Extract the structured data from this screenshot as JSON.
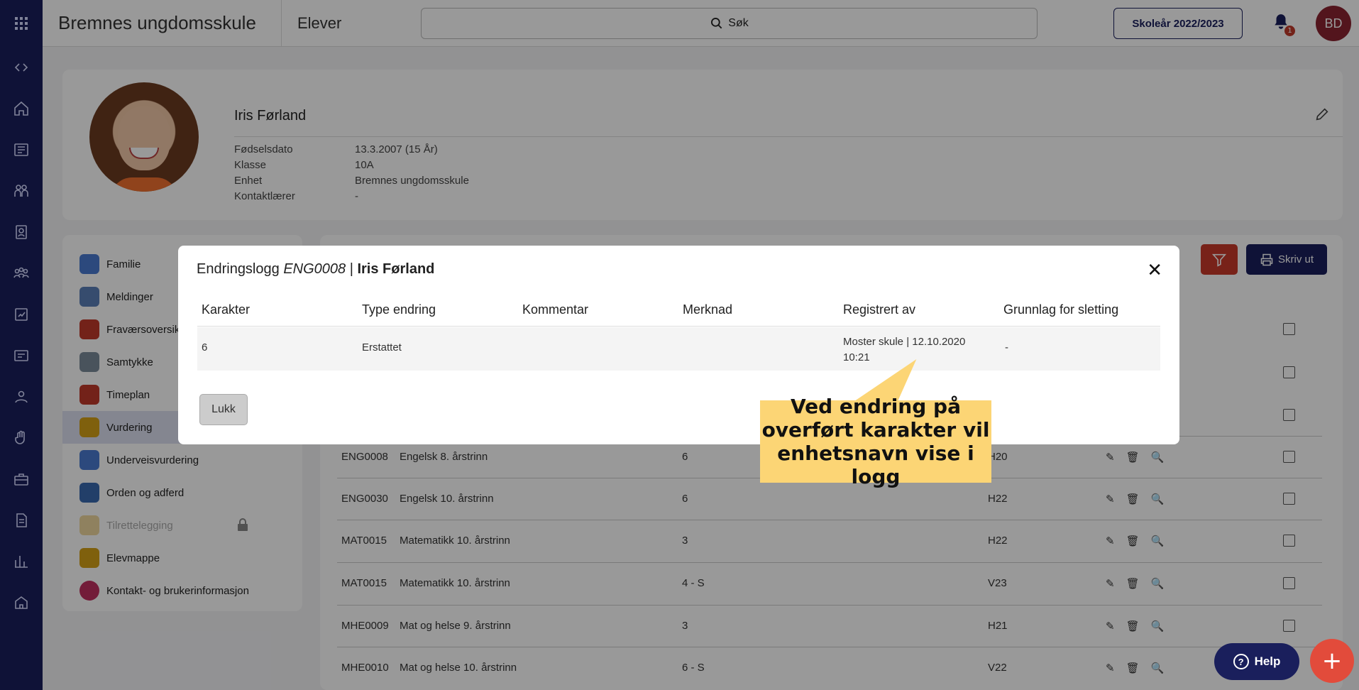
{
  "topbar": {
    "school_name": "Bremnes ungdomsskule",
    "section_title": "Elever",
    "search_label": "Søk",
    "year_button": "Skoleår 2022/2023",
    "notification_count": "1",
    "user_initials": "BD"
  },
  "profile": {
    "name": "Iris Førland",
    "fields": [
      {
        "label": "Fødselsdato",
        "value": "13.3.2007 (15 År)"
      },
      {
        "label": "Klasse",
        "value": "10A"
      },
      {
        "label": "Enhet",
        "value": "Bremnes ungdomsskule"
      },
      {
        "label": "Kontaktlærer",
        "value": "-"
      }
    ]
  },
  "menu": {
    "items": [
      {
        "label": "Familie",
        "color": "#4a7bd0"
      },
      {
        "label": "Meldinger",
        "color": "#5b7fb8"
      },
      {
        "label": "Fraværsoversikt",
        "color": "#c0392b"
      },
      {
        "label": "Samtykke",
        "color": "#7a8a9a"
      },
      {
        "label": "Timeplan",
        "color": "#c0392b"
      },
      {
        "label": "Vurdering",
        "color": "#d4a017"
      },
      {
        "label": "Underveisvurdering",
        "color": "#4a7bd0"
      },
      {
        "label": "Orden og adferd",
        "color": "#3a6ab0"
      },
      {
        "label": "Tilrettelegging",
        "color": "#e0b040"
      },
      {
        "label": "Elevmappe",
        "color": "#d4a017"
      },
      {
        "label": "Kontakt- og brukerinformasjon",
        "color": "#c03060"
      }
    ]
  },
  "toolbar": {
    "print_label": "Skriv ut"
  },
  "table": {
    "rows": [
      {
        "code": "ENG0008",
        "subject": "Engelsk 8. årstrinn",
        "grade": "6",
        "term": "H20"
      },
      {
        "code": "ENG0030",
        "subject": "Engelsk 10. årstrinn",
        "grade": "6",
        "term": "H22"
      },
      {
        "code": "MAT0015",
        "subject": "Matematikk 10. årstrinn",
        "grade": "3",
        "term": "H22"
      },
      {
        "code": "MAT0015",
        "subject": "Matematikk 10. årstrinn",
        "grade": "4 - S",
        "term": "V23"
      },
      {
        "code": "MHE0009",
        "subject": "Mat og helse 9. årstrinn",
        "grade": "3",
        "term": "H21"
      },
      {
        "code": "MHE0010",
        "subject": "Mat og helse 10. årstrinn",
        "grade": "6 - S",
        "term": "V22"
      }
    ]
  },
  "modal": {
    "title_prefix": "Endringslogg",
    "title_code": "ENG0008",
    "title_sep": " | ",
    "title_name": "Iris Førland",
    "columns": [
      "Karakter",
      "Type endring",
      "Kommentar",
      "Merknad",
      "Registrert av",
      "Grunnlag for sletting"
    ],
    "row": {
      "karakter": "6",
      "type_endring": "Erstattet",
      "kommentar": "",
      "merknad": "",
      "registrert_av": "Moster skule | 12.10.2020 10:21",
      "grunnlag": "-"
    },
    "close_button": "Lukk"
  },
  "callout": {
    "text": "Ved endring på overført karakter vil enhetsnavn vise i logg"
  },
  "help_button": "Help",
  "colors": {
    "navy": "#1a1f5c",
    "red": "#c8392b",
    "callout": "#fcd575"
  }
}
